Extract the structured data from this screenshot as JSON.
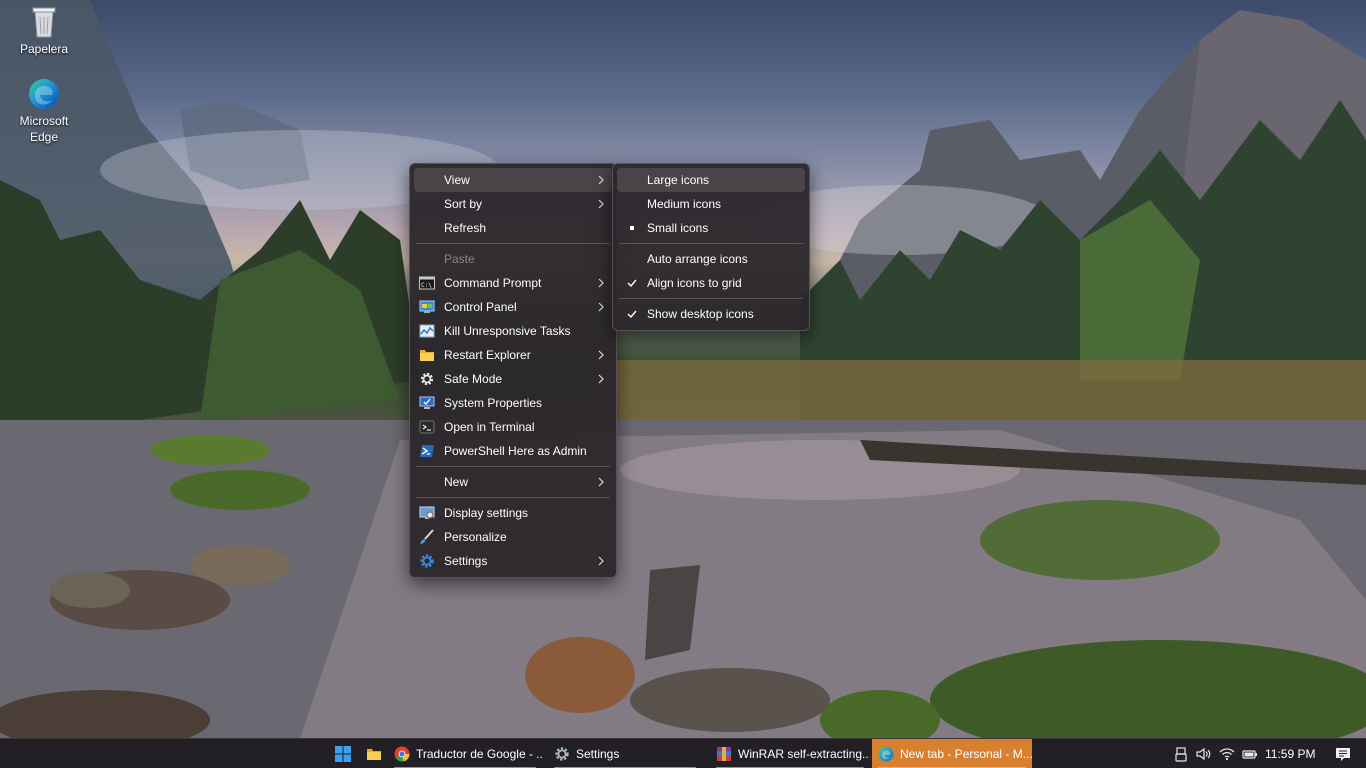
{
  "desktop": {
    "icons": [
      {
        "label": "Papelera",
        "icon": "recycle-bin-icon"
      },
      {
        "label": "Microsoft Edge",
        "icon": "edge-icon"
      }
    ]
  },
  "context_menu": {
    "items": [
      {
        "label": "View",
        "submenu": true,
        "highlighted": true
      },
      {
        "label": "Sort by",
        "submenu": true
      },
      {
        "label": "Refresh"
      },
      {
        "label": "Paste",
        "disabled": true
      },
      {
        "label": "Command Prompt",
        "submenu": true,
        "icon": "command-prompt-icon"
      },
      {
        "label": "Control Panel",
        "submenu": true,
        "icon": "control-panel-icon"
      },
      {
        "label": "Kill Unresponsive Tasks",
        "icon": "task-manager-icon"
      },
      {
        "label": "Restart Explorer",
        "submenu": true,
        "icon": "folder-icon"
      },
      {
        "label": "Safe Mode",
        "submenu": true,
        "icon": "gear-icon"
      },
      {
        "label": "System Properties",
        "icon": "computer-icon"
      },
      {
        "label": "Open in Terminal",
        "icon": "terminal-icon"
      },
      {
        "label": "PowerShell Here as Admin",
        "icon": "powershell-icon"
      },
      {
        "label": "New",
        "submenu": true
      },
      {
        "label": "Display settings",
        "icon": "display-icon"
      },
      {
        "label": "Personalize",
        "icon": "brush-icon"
      },
      {
        "label": "Settings",
        "submenu": true,
        "icon": "settings-gear-icon"
      }
    ]
  },
  "view_submenu": {
    "items": [
      {
        "label": "Large icons",
        "highlighted": true
      },
      {
        "label": "Medium icons"
      },
      {
        "label": "Small icons",
        "mark": "bullet"
      },
      {
        "label": "Auto arrange icons"
      },
      {
        "label": "Align icons to grid",
        "mark": "check"
      },
      {
        "label": "Show desktop icons",
        "mark": "check"
      }
    ]
  },
  "taskbar": {
    "apps": [
      {
        "label": "Traductor de Google - ...",
        "icon": "chrome-icon"
      },
      {
        "label": "Settings",
        "icon": "settings-icon"
      },
      {
        "label": "WinRAR self-extracting...",
        "icon": "winrar-icon"
      },
      {
        "label": "New tab - Personal - M...",
        "icon": "edge-icon",
        "active": true
      }
    ],
    "clock": "11:59 PM",
    "colors": {
      "active_button": "#d88030",
      "indicator": "#6aa0d0",
      "background": "#222024"
    }
  }
}
